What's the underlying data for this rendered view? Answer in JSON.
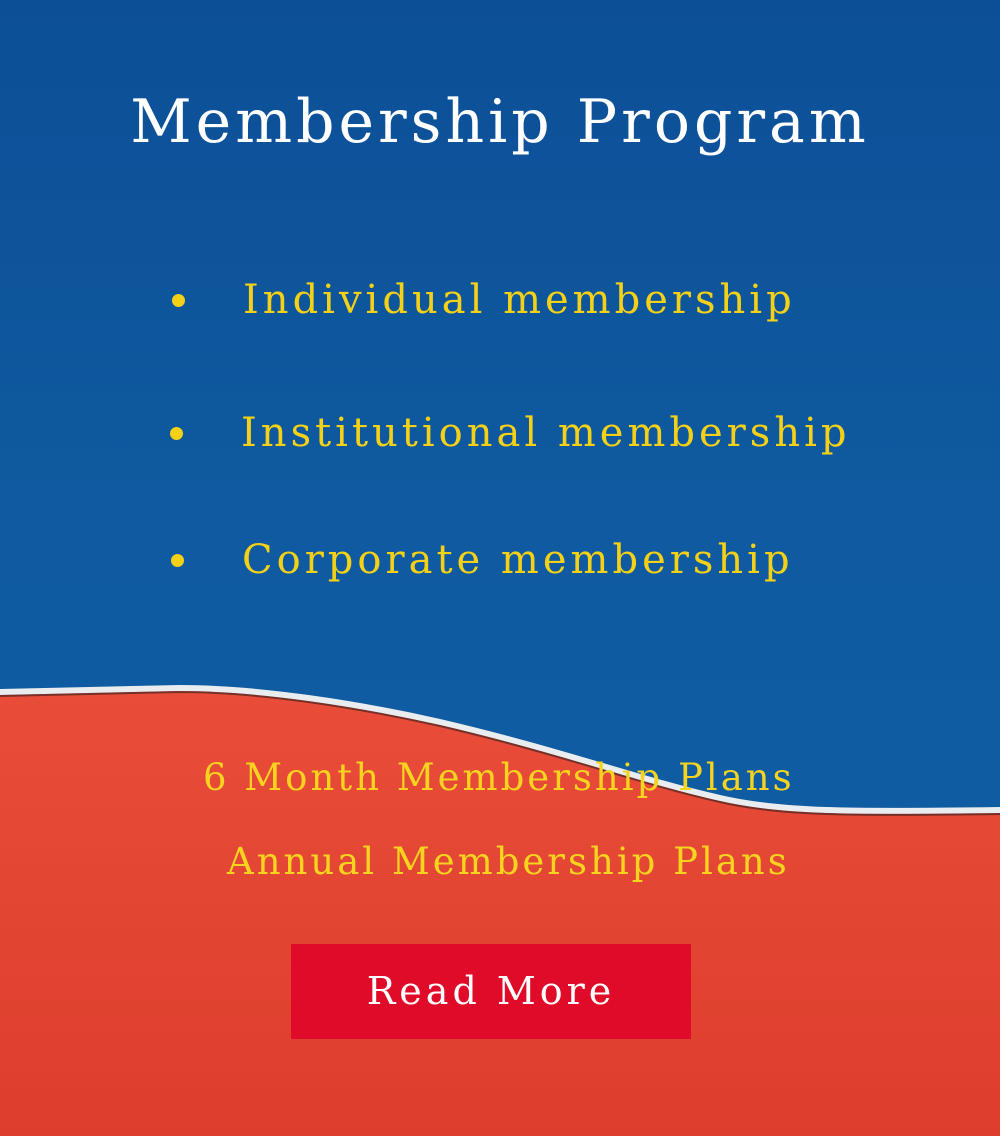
{
  "title": "Membership Program",
  "membership_types": [
    {
      "label": "Individual membership"
    },
    {
      "label": "Institutional membership"
    },
    {
      "label": "Corporate membership"
    }
  ],
  "plans": [
    "6 Month Membership Plans",
    "Annual Membership Plans"
  ],
  "cta": {
    "label": "Read More"
  },
  "colors": {
    "background_blue": "#0f5aa0",
    "background_red": "#e64a37",
    "text_white": "#ffffff",
    "accent_yellow": "#f4d117",
    "button_red": "#df0b28"
  },
  "icons": {
    "bullet": "bullet-dot-icon"
  }
}
